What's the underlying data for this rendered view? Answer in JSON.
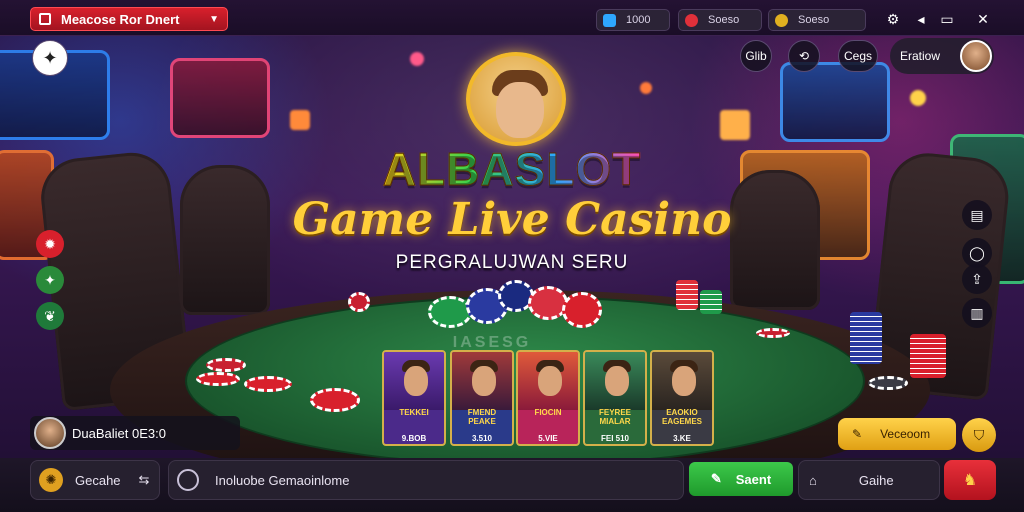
{
  "topbar": {
    "selector_label": "Meacose Ror Dnert",
    "balances": [
      {
        "value": "1000",
        "color": "#2ea7ff",
        "icon": "gem-icon"
      },
      {
        "value": "Soeso",
        "color": "#e0303a",
        "icon": "ruby-icon"
      },
      {
        "value": "Soeso",
        "color": "#e0b020",
        "icon": "coin-icon"
      }
    ],
    "icons": [
      "settings-icon",
      "volume-icon",
      "window-icon",
      "close-icon"
    ]
  },
  "header_actions": {
    "btn1": "Glib",
    "btn2": "⟲",
    "btn3": "Cegs",
    "profile_name": "Eratiow"
  },
  "title": {
    "brand": "ALBASLOT",
    "headline": "Game Live Casino",
    "tagline": "PERGRALUJWAN SERU"
  },
  "table": {
    "felt_text": "IASESG"
  },
  "cards": [
    {
      "name": "TEKKEI",
      "value": "9.BOB",
      "bg": "#4b2a8a"
    },
    {
      "name": "FMEND PEAKE",
      "value": "3.510",
      "bg": "#2a3a8a"
    },
    {
      "name": "FIOCIN",
      "value": "5.VIE",
      "bg": "#b8245a"
    },
    {
      "name": "FEYREE MIALAR",
      "value": "FEI 510",
      "bg": "#2a6a3a"
    },
    {
      "name": "EAOKIO EAGEMES",
      "value": "3.KE",
      "bg": "#3a3a44"
    }
  ],
  "left_player": {
    "name": "DuaBaliet 0E3:0"
  },
  "actions": {
    "yellow_btn": "Veceoom",
    "green_btn": "Saent"
  },
  "bottombar": {
    "left_label": "Gecahe",
    "chat_placeholder": "Inoluobe Gemaoinlome",
    "right_label": "Gaihe"
  },
  "colors": {
    "accent_red": "#d8202c",
    "accent_gold": "#ffcf3a",
    "accent_green": "#2fb63e",
    "felt": "#1f6b35"
  }
}
